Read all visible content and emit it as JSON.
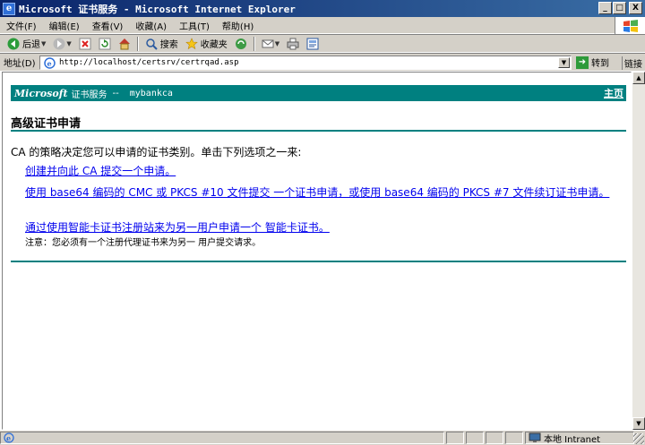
{
  "window": {
    "title": "Microsoft 证书服务 - Microsoft Internet Explorer",
    "controls": {
      "minimize": "_",
      "maximize": "□",
      "close": "X"
    }
  },
  "menubar": {
    "items": [
      "文件(F)",
      "编辑(E)",
      "查看(V)",
      "收藏(A)",
      "工具(T)",
      "帮助(H)"
    ]
  },
  "toolbar": {
    "back_label": "后退",
    "search_label": "搜索",
    "favorites_label": "收藏夹"
  },
  "addressbar": {
    "label": "地址(D)",
    "url": "http://localhost/certsrv/certrqad.asp",
    "go_label": "转到",
    "links_label": "链接"
  },
  "banner": {
    "brand": "Microsoft",
    "service": "证书服务",
    "separator": "--",
    "ca_name": "mybankca",
    "home_link": "主页",
    "color": "#008080"
  },
  "page": {
    "title": "高级证书申请",
    "intro": "CA 的策略决定您可以申请的证书类别。单击下列选项之一来:",
    "options": [
      "创建并向此 CA 提交一个申请。",
      "使用 base64 编码的 CMC 或 PKCS #10 文件提交 一个证书申请，或使用 base64 编码的 PKCS #7 文件续订证书申请。",
      "通过使用智能卡证书注册站来为另一用户申请一个 智能卡证书。"
    ],
    "note": "注意：您必须有一个注册代理证书来为另一 用户提交请求。"
  },
  "statusbar": {
    "zone": "本地 Intranet"
  }
}
